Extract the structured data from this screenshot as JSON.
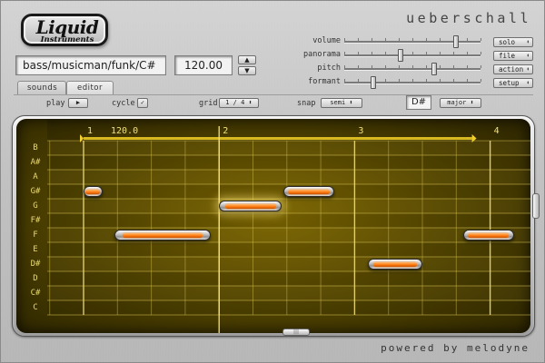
{
  "logo": {
    "word": "Liquid",
    "sub": "Instruments"
  },
  "brand": "ueberschall",
  "preset": {
    "path": "bass/musicman/funk/C#"
  },
  "tempo": {
    "value": "120.00"
  },
  "tabs": [
    {
      "label": "sounds"
    },
    {
      "label": "editor"
    }
  ],
  "sliders": [
    {
      "label": "volume",
      "value": 0.82
    },
    {
      "label": "panorama",
      "value": 0.41
    },
    {
      "label": "pitch",
      "value": 0.66
    },
    {
      "label": "formant",
      "value": 0.21
    }
  ],
  "side_buttons": [
    {
      "label": "solo"
    },
    {
      "label": "file"
    },
    {
      "label": "action"
    },
    {
      "label": "setup"
    }
  ],
  "controls": {
    "play_label": "play",
    "play_button": "▶",
    "cycle_label": "cycle",
    "cycle_button": "✓",
    "grid_label": "grid",
    "grid_value": "1 / 4",
    "snap_label": "snap",
    "snap_value": "semi",
    "key_value": "D#",
    "scale_value": "major"
  },
  "editor": {
    "bars": [
      "1",
      "2",
      "3",
      "4"
    ],
    "tempo_marker": "120.0",
    "pitches": [
      "B",
      "A#",
      "A",
      "G#",
      "G",
      "F#",
      "F",
      "E",
      "D#",
      "D",
      "C#",
      "C"
    ],
    "notes": [
      {
        "pitch": "G#",
        "start_beat": 0.0,
        "length_beats": 0.55
      },
      {
        "pitch": "F",
        "start_beat": 0.9,
        "length_beats": 2.85
      },
      {
        "pitch": "G",
        "start_beat": 4.0,
        "length_beats": 1.85,
        "selected": true
      },
      {
        "pitch": "G#",
        "start_beat": 5.9,
        "length_beats": 1.5
      },
      {
        "pitch": "D#",
        "start_beat": 8.4,
        "length_beats": 1.6
      },
      {
        "pitch": "F",
        "start_beat": 11.2,
        "length_beats": 1.5
      }
    ]
  },
  "colors": {
    "accent": "#ff7a10",
    "grid_bg": "#5a4a00",
    "grid_line": "#c8b030"
  },
  "footer": "powered by melodyne"
}
